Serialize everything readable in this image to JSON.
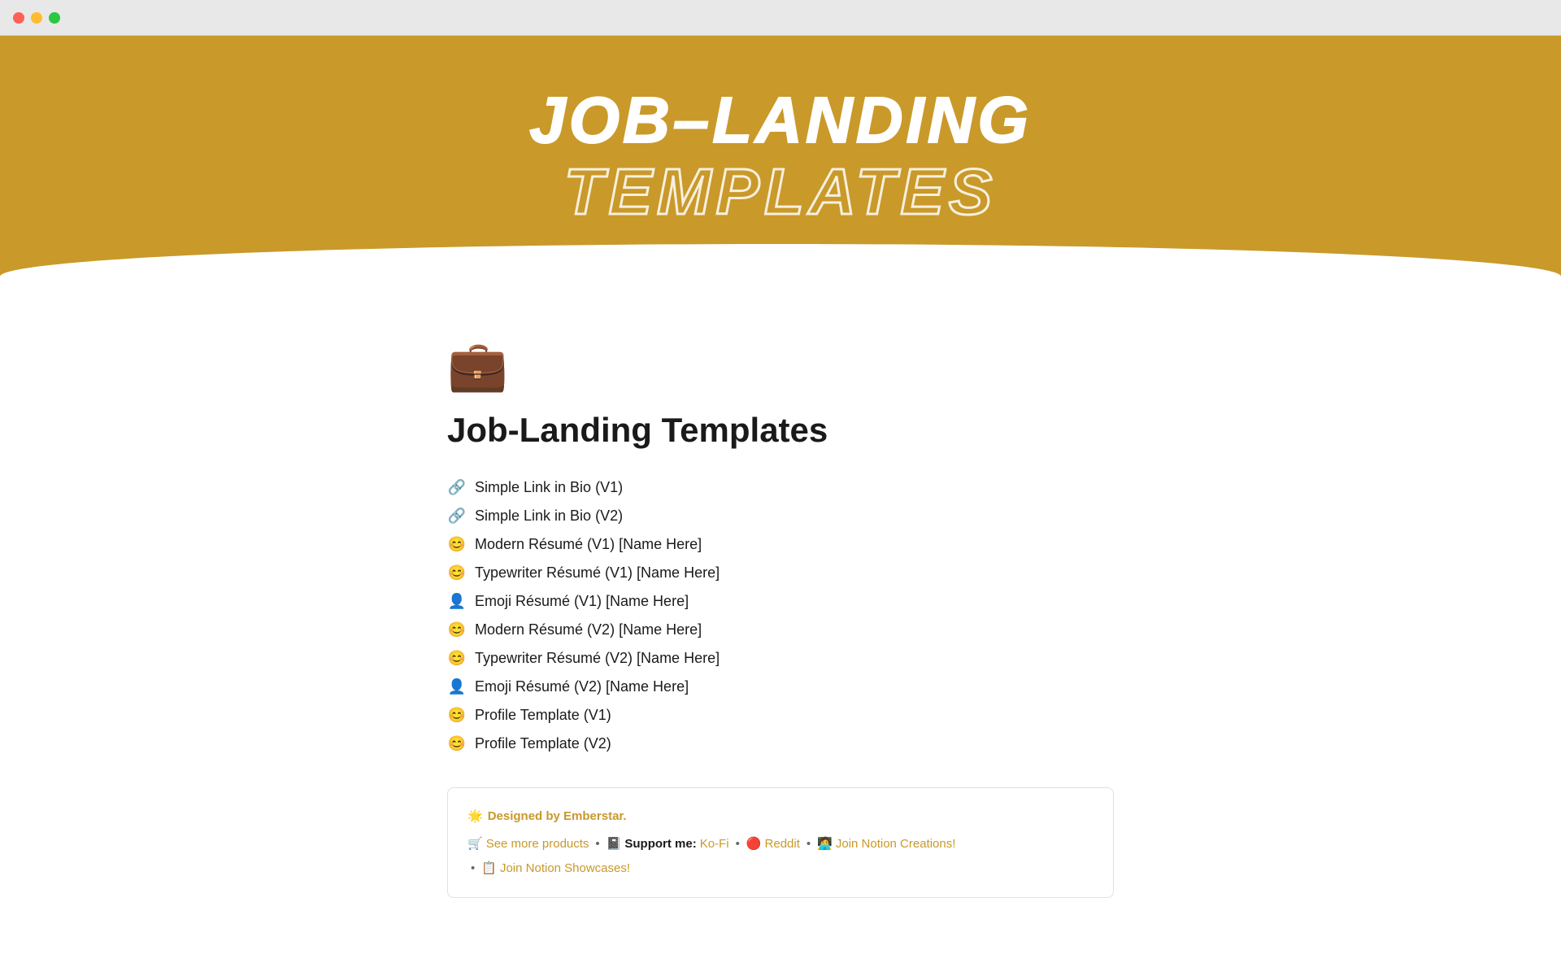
{
  "window": {
    "traffic_lights": [
      "red",
      "yellow",
      "green"
    ]
  },
  "hero": {
    "title_main": "JOB–LANDING",
    "title_sub": "TEMPLATES"
  },
  "page": {
    "icon": "💼",
    "title": "Job-Landing Templates"
  },
  "template_list": [
    {
      "icon": "🔗",
      "text": "Simple Link in Bio (V1)"
    },
    {
      "icon": "🔗",
      "text": "Simple Link in Bio (V2)"
    },
    {
      "icon": "😊",
      "text": "Modern Résumé (V1) [Name Here]"
    },
    {
      "icon": "😊",
      "text": "Typewriter Résumé (V1) [Name Here]"
    },
    {
      "icon": "👤",
      "text": "Emoji Résumé (V1) [Name Here]"
    },
    {
      "icon": "😊",
      "text": "Modern Résumé (V2) [Name Here]"
    },
    {
      "icon": "😊",
      "text": "Typewriter Résumé (V2) [Name Here]"
    },
    {
      "icon": "👤",
      "text": "Emoji Résumé (V2) [Name Here]"
    },
    {
      "icon": "😊",
      "text": "Profile Template (V1)"
    },
    {
      "icon": "😊",
      "text": "Profile Template (V2)"
    }
  ],
  "footer": {
    "designer_icon": "🌟",
    "designer_label": "Designed by Emberstar.",
    "cart_icon": "🛒",
    "see_more": "See more products",
    "bullet1": "•",
    "notebook_icon": "📓",
    "support_label": "Support me:",
    "kofi": "Ko-Fi",
    "bullet2": "•",
    "reddit_icon": "🔴",
    "reddit": "Reddit",
    "bullet3": "•",
    "notion_icon": "🧑‍💻",
    "join_notion": "Join Notion Creations!",
    "bullet4": "•",
    "showcase_icon": "📋",
    "join_showcase": "Join Notion Showcases!"
  }
}
